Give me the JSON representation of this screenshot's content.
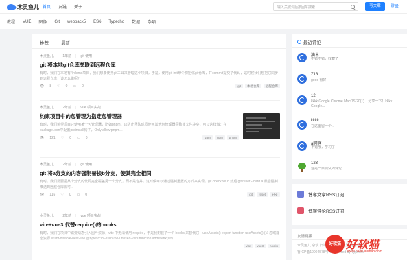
{
  "header": {
    "logo_text": "木灵鱼儿",
    "nav": [
      "首页",
      "友链",
      "关于"
    ],
    "search_placeholder": "输入关键词后按回车搜索",
    "write_button": "写文章",
    "login": "登录"
  },
  "categories": [
    "教程",
    "VUE",
    "图像",
    "Git",
    "webpack5",
    "ES6",
    "Typecho",
    "数据",
    "杂项"
  ],
  "tabs": [
    "推荐",
    "最新"
  ],
  "articles": [
    {
      "author": "木灵鱼儿",
      "time": "1年前",
      "category": "git 使用",
      "title": "git 将本地git仓库关联到远程仓库",
      "desc": "有时，我们在本地有个demo项目，我们想要使用git工具来管理这个项目，于是，使用git init命令初始化git仓库，并commit提交了代码，这时候我们想把它同步到远程仓库，该怎么做呢？",
      "views": "8",
      "likes": "0",
      "comments": "0",
      "tags": [
        "git",
        "本地仓库",
        "远程仓库"
      ]
    },
    {
      "author": "木灵鱼儿",
      "time": "2年前",
      "category": "vue 项目实战",
      "title": "约束项目中的包管理为指定包管理器",
      "desc": "有时，我们希望项目只使用某个包管理器，比如pnpm，以防止团队成员使用其他包管理器导致锁文件冲突，可以这样做：在package.json中配置preinstall钩子，Only allow pnpm...",
      "views": "121",
      "likes": "0",
      "comments": "0",
      "tags": [
        "yarn",
        "npm",
        "pnpm"
      ]
    },
    {
      "author": "木灵鱼儿",
      "time": "2年前",
      "category": "git 使用",
      "title": "git 将a分支的内容强制替换b分支，使其完全相同",
      "desc": "有时，我们需要把某个分支的代码完全覆盖另一个分支，而不是合并，这时候可以通过强制重置的方式来实现，git checkout b 然后 git reset --hard a 最后强制推送到远程仓库即可...",
      "views": "116",
      "likes": "0",
      "comments": "0",
      "tags": [
        "git",
        "reset",
        "分支"
      ]
    },
    {
      "author": "木灵鱼儿",
      "time": "2年前",
      "category": "vue 项目实战",
      "title": "vite+vue3 代替require()的hooks",
      "desc": "有时，我们在项目中需要动态引入图片资源，vite 中无法使用 require，于是我封装了一个 hooks 来替代它：useAssets() export function useAssets() { // 忽略静态资源 eslint-disable-next-line @typescript-eslint/no-unused-vars function addPrefix(str)...",
      "views": "",
      "likes": "",
      "comments": "",
      "tags": [
        "vite",
        "vue3",
        "hooks"
      ]
    }
  ],
  "sidebar": {
    "title": "最近评论",
    "comments": [
      {
        "name": "猫木",
        "text": "不错不错，收藏了"
      },
      {
        "name": "Z13",
        "text": "good 很好"
      },
      {
        "name": "12",
        "text": "kkkk Google Chrome MacOS 20(1)... 分享一下！kkkk Google..."
      },
      {
        "name": "kkkk",
        "text": "在这里留一个..."
      },
      {
        "name": "a啊啊",
        "text": "不错哦，学习了"
      },
      {
        "name": "123",
        "text": "这是一条测试的评论"
      }
    ],
    "rss": [
      "博客文章RSS订阅",
      "博客评论RSS订阅"
    ],
    "friends_title": "友情链接",
    "friends_text": [
      "木灵鱼儿 杂谈 旧站 主站 记录生活 博客导航",
      "鲁ICP备19004578号-1 Powered by Typecho"
    ]
  },
  "watermark": {
    "badge": "好软猫",
    "text": "好软猫",
    "url": "www.haoruanmao.com"
  },
  "colors": {
    "accent": "#1e80ff",
    "watermark": "#e8352b"
  }
}
